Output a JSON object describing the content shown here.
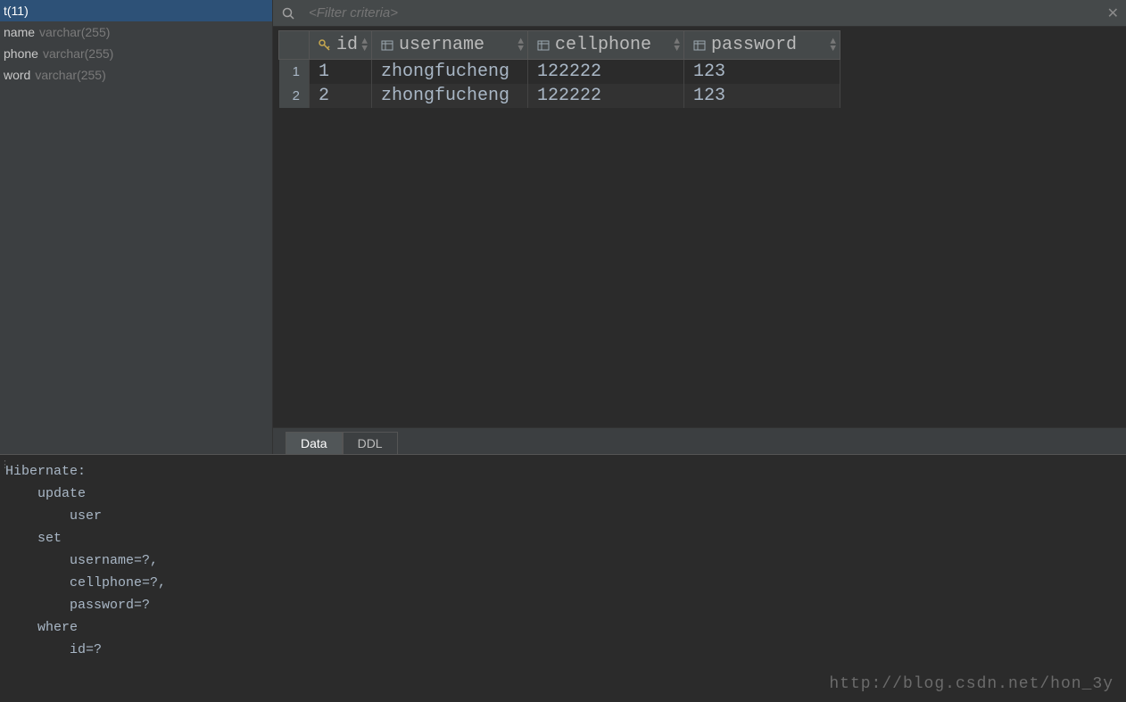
{
  "sidebar": {
    "columns": [
      {
        "name": "t(11)",
        "type": "",
        "selected": true
      },
      {
        "name": "name",
        "type": "varchar(255)",
        "selected": false
      },
      {
        "name": "phone",
        "type": "varchar(255)",
        "selected": false
      },
      {
        "name": "word",
        "type": "varchar(255)",
        "selected": false
      }
    ]
  },
  "filter": {
    "placeholder": "<Filter criteria>"
  },
  "table": {
    "columns": [
      "id",
      "username",
      "cellphone",
      "password"
    ],
    "rows": [
      {
        "n": "1",
        "id": "1",
        "username": "zhongfucheng",
        "cellphone": "122222",
        "password": "123"
      },
      {
        "n": "2",
        "id": "2",
        "username": "zhongfucheng",
        "cellphone": "122222",
        "password": "123"
      }
    ]
  },
  "tabs": {
    "data": "Data",
    "ddl": "DDL"
  },
  "console": {
    "text": "Hibernate: \n    update\n        user \n    set\n        username=?,\n        cellphone=?,\n        password=? \n    where\n        id=?"
  },
  "watermark": "http://blog.csdn.net/hon_3y"
}
